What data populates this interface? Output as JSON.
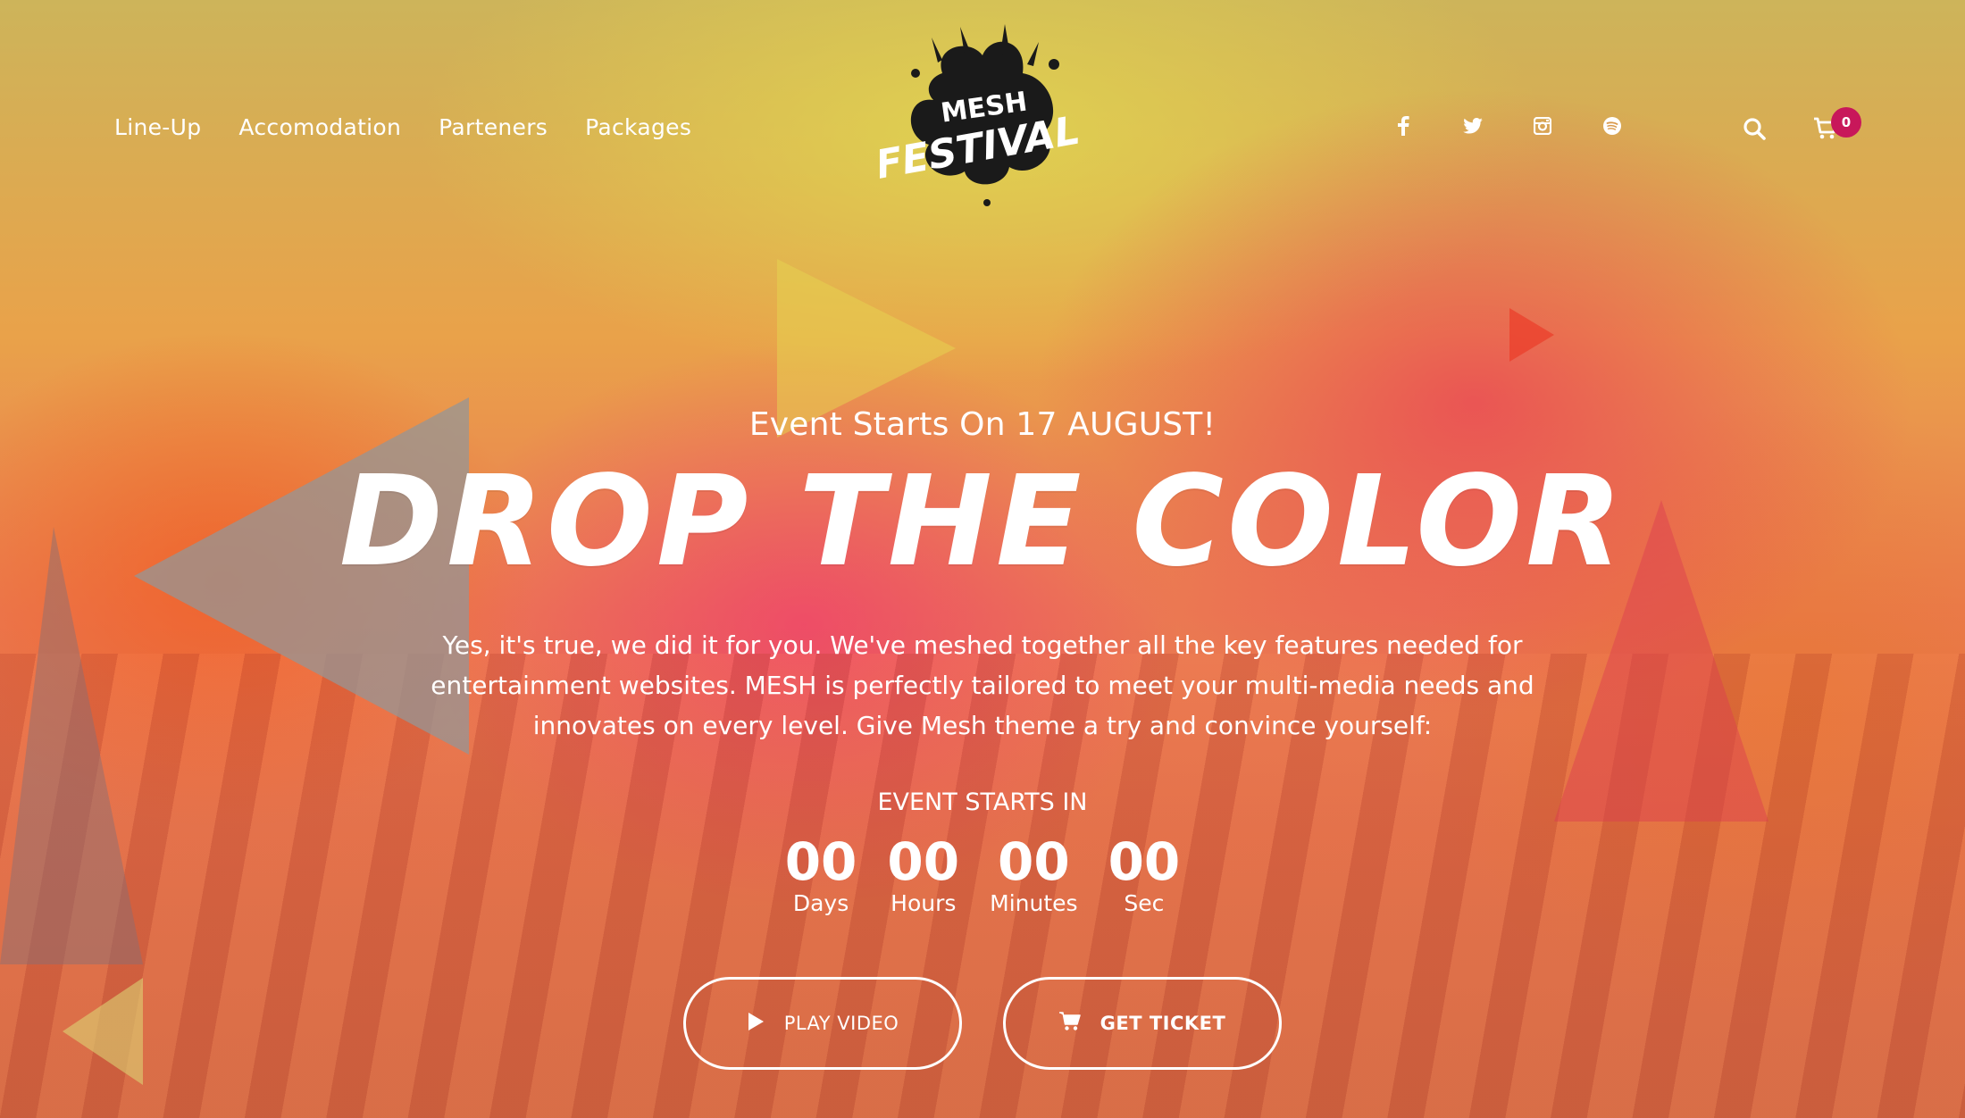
{
  "nav": {
    "items": [
      {
        "label": "Line-Up"
      },
      {
        "label": "Accomodation"
      },
      {
        "label": "Parteners"
      },
      {
        "label": "Packages"
      }
    ]
  },
  "logo": {
    "line1": "MESH",
    "line2": "FESTIVAL"
  },
  "social": [
    "facebook-icon",
    "twitter-icon",
    "instagram-icon",
    "spotify-icon"
  ],
  "cart": {
    "count": "0"
  },
  "hero": {
    "eyebrow": "Event Starts On 17 AUGUST!",
    "headline": "DROP THE COLOR",
    "description": "Yes, it's true, we did it for you. We've meshed together all the key features needed for entertainment websites. MESH is perfectly tailored to meet your multi-media needs and innovates on every level. Give Mesh theme a try and convince yourself:"
  },
  "countdown": {
    "label": "EVENT STARTS IN",
    "units": [
      {
        "value": "00",
        "label": "Days"
      },
      {
        "value": "00",
        "label": "Hours"
      },
      {
        "value": "00",
        "label": "Minutes"
      },
      {
        "value": "00",
        "label": "Sec"
      }
    ]
  },
  "buttons": {
    "play": "PLAY VIDEO",
    "ticket": "GET TICKET"
  },
  "colors": {
    "badge": "#c8175a",
    "text": "#ffffff"
  }
}
